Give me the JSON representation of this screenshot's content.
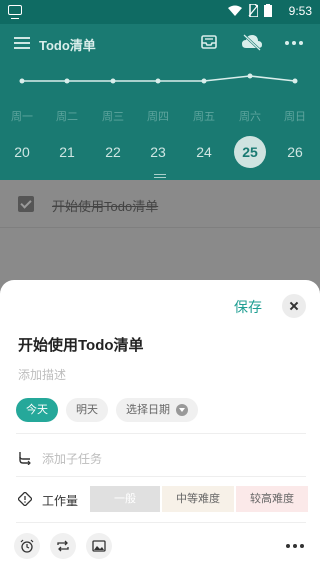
{
  "status_bar": {
    "time": "9:53"
  },
  "header": {
    "title": "Todo清单",
    "weekdays": [
      "周一",
      "周二",
      "周三",
      "周四",
      "周五",
      "周六",
      "周日"
    ],
    "dates": [
      "20",
      "21",
      "22",
      "23",
      "24",
      "25",
      "26"
    ],
    "selected_date": "25",
    "trend_values": [
      0,
      0,
      0,
      0,
      0,
      1,
      0
    ]
  },
  "list": {
    "items": [
      {
        "text": "开始使用Todo清单",
        "done": true
      }
    ]
  },
  "sheet": {
    "save_label": "保存",
    "task_title": "开始使用Todo清单",
    "description_placeholder": "添加描述",
    "date_chips": [
      "今天",
      "明天",
      "选择日期"
    ],
    "subtask_placeholder": "添加子任务",
    "workload_label": "工作量",
    "workload_options": [
      "一般",
      "中等难度",
      "较高难度"
    ]
  },
  "colors": {
    "accent": "#1f9e92",
    "header": "#1a7a72"
  },
  "icons": {
    "header": [
      "menu-icon",
      "inbox-icon",
      "cloud-off-icon",
      "more-icon"
    ],
    "sheet": [
      "close-icon",
      "subtask-icon",
      "workload-icon",
      "alarm-icon",
      "repeat-icon",
      "image-icon",
      "more-icon"
    ]
  }
}
